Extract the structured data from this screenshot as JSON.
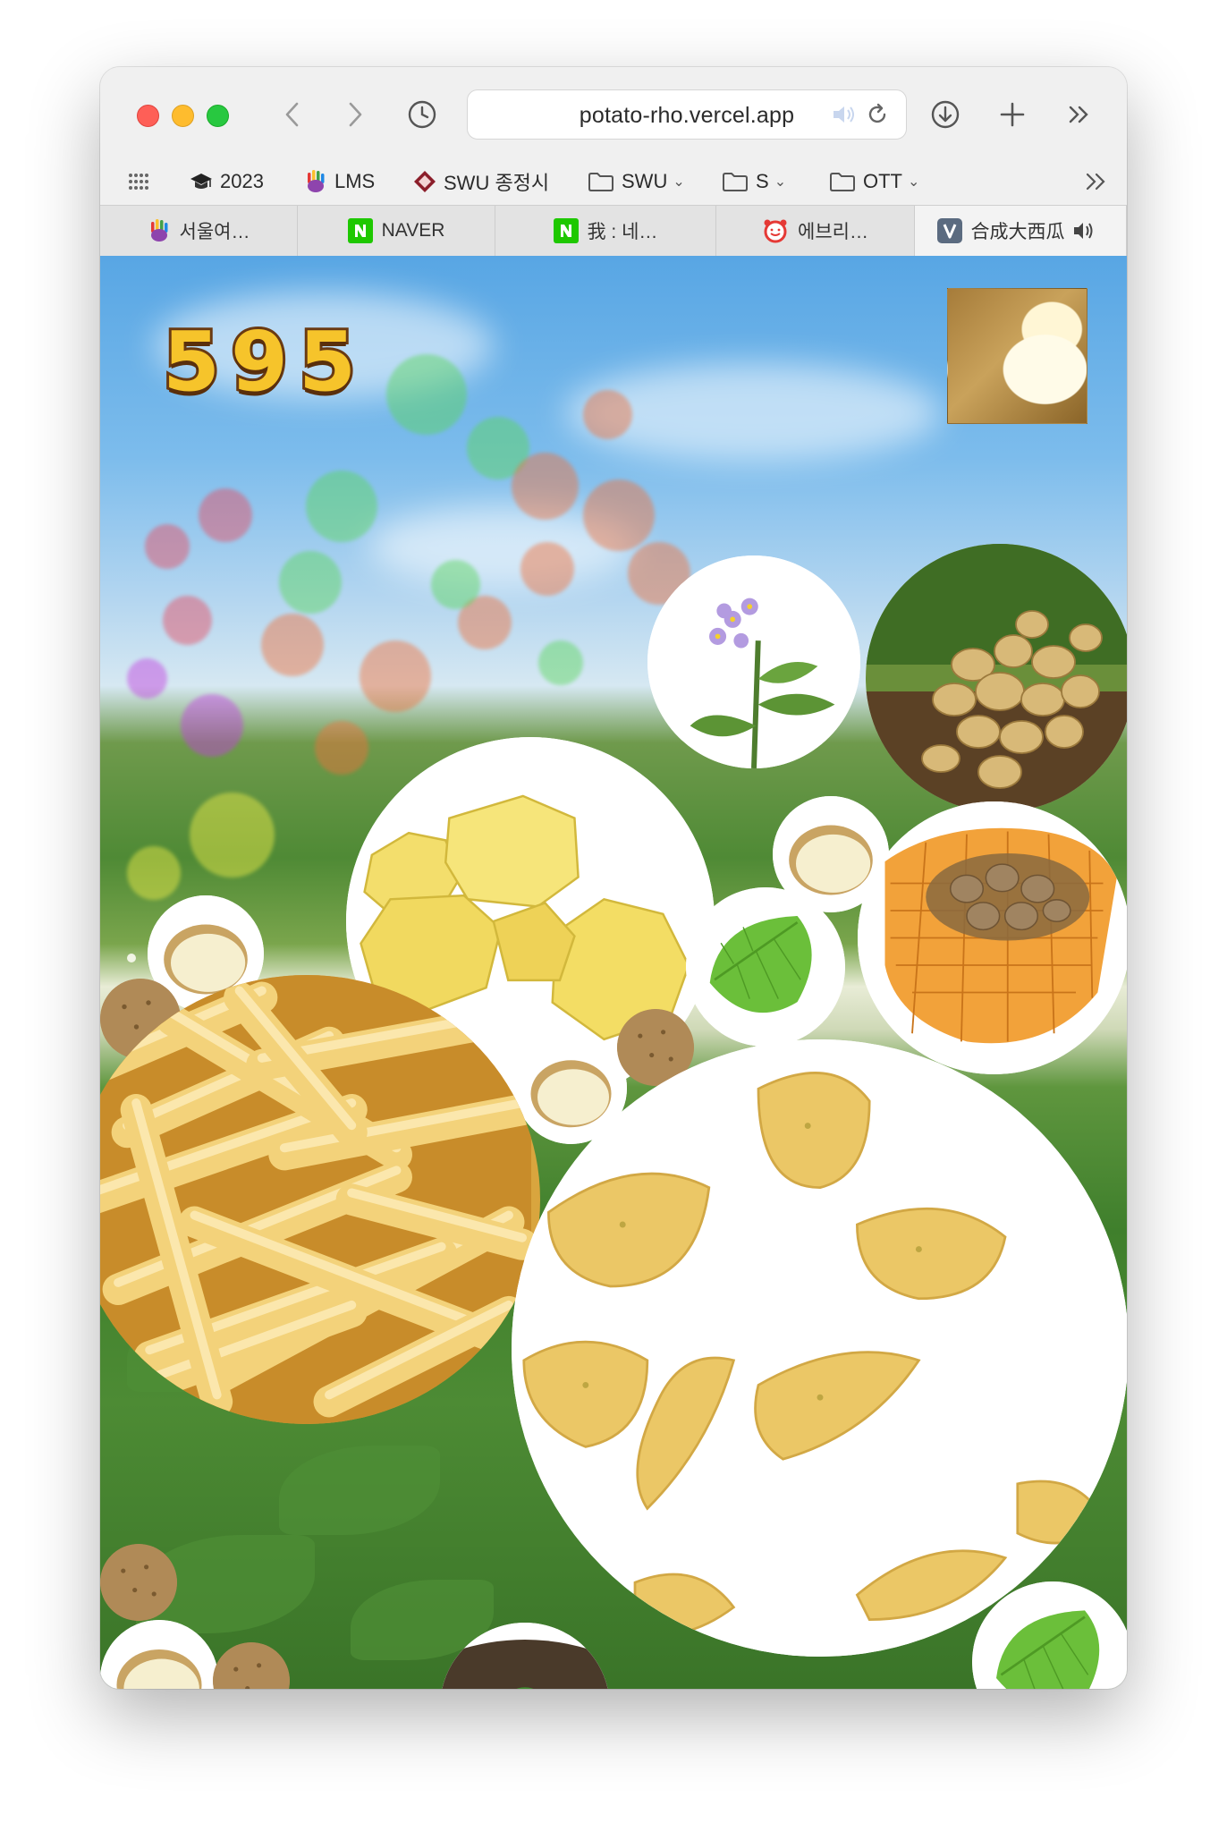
{
  "browser": {
    "url": "potato-rho.vercel.app",
    "bookmarks": [
      {
        "label": "2023",
        "icon": "graduation-cap-icon"
      },
      {
        "label": "LMS",
        "icon": "hand-logo-icon"
      },
      {
        "label": "SWU 종정시",
        "icon": "swu-logo-icon"
      },
      {
        "label": "SWU",
        "icon": "folder-icon"
      },
      {
        "label": "S",
        "icon": "folder-icon"
      },
      {
        "label": "OTT",
        "icon": "folder-icon"
      }
    ],
    "tabs": [
      {
        "label": "서울여…",
        "icon": "hand-logo-icon"
      },
      {
        "label": "NAVER",
        "icon": "naver-icon"
      },
      {
        "label": "我 : 네…",
        "icon": "naver-icon"
      },
      {
        "label": "에브리…",
        "icon": "alarm-clock-icon"
      },
      {
        "label": "合成大西瓜",
        "icon": "v-logo-icon"
      }
    ]
  },
  "game": {
    "score": "595",
    "colors": {
      "score_fill": "#f6c42b",
      "score_outline": "#6a3a12",
      "splash_red": "#e84a5f",
      "splash_green": "#5ad65a",
      "splash_orange": "#f0703a",
      "splash_purple": "#c33ee0",
      "splash_yellow": "#f4f04a"
    },
    "items": [
      {
        "name": "potato-flower-bubble",
        "image": "potato-flower"
      },
      {
        "name": "harvested-potatoes-bubble",
        "image": "potato-pile"
      },
      {
        "name": "peeled-potatoes-bubble",
        "image": "peeled-potatoes"
      },
      {
        "name": "half-potato-bubble",
        "image": "potato-half"
      },
      {
        "name": "potato-sack-bubble",
        "image": "potato-sack"
      },
      {
        "name": "potato-leaf-bubble",
        "image": "potato-leaf"
      },
      {
        "name": "french-fries-bubble",
        "image": "french-fries"
      },
      {
        "name": "potato-chips-bubble",
        "image": "potato-chips"
      },
      {
        "name": "sprout-bubble",
        "image": "potato-sprout"
      },
      {
        "name": "seed-potato-bubble",
        "image": "seed-potato"
      }
    ]
  }
}
